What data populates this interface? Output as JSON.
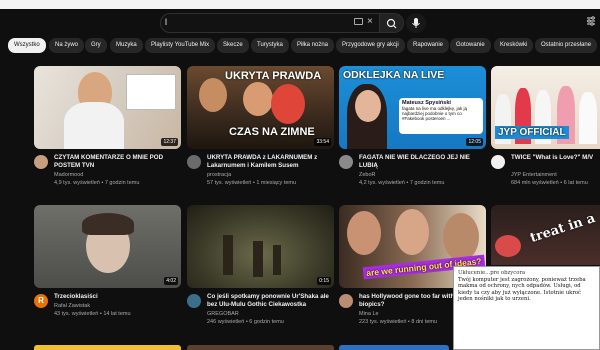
{
  "search": {
    "value": "l"
  },
  "chips": [
    "Wszystko",
    "Na żywo",
    "Gry",
    "Muzyka",
    "Playlisty YouTube Mix",
    "Skecze",
    "Turystyka",
    "Piłka nożna",
    "Przygodowe gry akcji",
    "Rapowanie",
    "Gotowanie",
    "Kreskówki",
    "Ostatnio przesłane"
  ],
  "videos": [
    {
      "title": "CZYTAM KOMENTARZE O MNIE POD POSTEM TVN",
      "channel": "Madormood",
      "views": "4,9 tys. wyświetleń",
      "age": "7 godzin temu",
      "duration": "12:37"
    },
    {
      "title": "UKRYTA PRAWDA z LAKARNUMEM z Lakarnumem i Kamilem Susem",
      "channel": "prostracja",
      "views": "57 tys. wyświetleń",
      "age": "1 miesiący temu",
      "duration": "33:54",
      "overlay": "CZAS NA ZIMNE",
      "overlay_small": "UKRYTA PRAWDA"
    },
    {
      "title": "FAGATA NIE WIE DLACZEGO JEJ NIE LUBIĄ",
      "channel": "ZeboR",
      "views": "4,2 tys. wyświetleń",
      "age": "7 godzin temu",
      "duration": "12:05",
      "overlay": "ODKLEJKA NA LIVE",
      "badge_name": "Mateusz Spysiński",
      "badge_text": "fagata na live ma odklejkę, jak ją najbardziej podobnie o tym co #Fakebook posteroen ..."
    },
    {
      "title": "TWICE \"What is Love?\" M/V",
      "channel": "JYP Entertainment",
      "views": "684 mln wyświetleń",
      "age": "6 lat temu",
      "overlay": "JYP OFFICIAL"
    },
    {
      "title": "Trzecioklasiści",
      "channel": "Rafał Zawistak",
      "views": "43 tys. wyświetleń",
      "age": "14 lat temu",
      "duration": "4:02",
      "avatar_letter": "R"
    },
    {
      "title": "Co jeśli spotkamy ponownie Ur'Shaka ale bez Ulu-Mulu Gothic Ciekawostka",
      "channel": "GREGOBAR",
      "views": "246 wyświetleń",
      "age": "6 godzin temu",
      "duration": "0:15"
    },
    {
      "title": "has Hollywood gone too far with biopics?",
      "channel": "Mina Le",
      "views": "223 tys. wyświetleń",
      "age": "8 dni temu",
      "overlay": "are we running out of ideas?"
    },
    {
      "title": "",
      "channel": "",
      "views": "",
      "age": "",
      "overlay": "treat in a"
    }
  ],
  "tooltip": {
    "head": "Ukłucenie...pre obzycora",
    "body": "Twój komputer jest zagrożony, ponieważ trzeba makma od ochrony, nych odpadów. Usługi, od kiedy ta czy aby już wyłączone. Istotnie ukroć jeden nośniki jak to urzeni."
  },
  "colors": {
    "bg": "#0f0f0f",
    "chip": "#272727",
    "chip_active": "#f1f1f1",
    "meta": "#aaaaaa",
    "twice_blue": "#1e8bd6"
  }
}
